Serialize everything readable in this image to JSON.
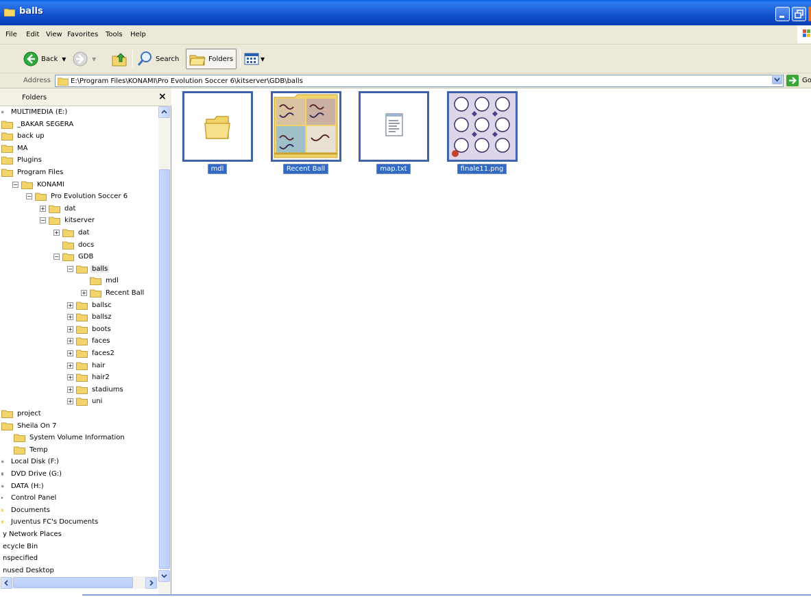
{
  "window": {
    "title": "balls",
    "controls": [
      "minimize",
      "restore"
    ]
  },
  "menu": [
    "File",
    "Edit",
    "View",
    "Favorites",
    "Tools",
    "Help"
  ],
  "toolbar": {
    "back_label": "Back",
    "search_label": "Search",
    "folders_label": "Folders"
  },
  "address": {
    "label": "Address",
    "path": "E:\\Program Files\\KONAMI\\Pro Evolution Soccer 6\\kitserver\\GDB\\balls",
    "go_label": "Go"
  },
  "folders_pane": {
    "title": "Folders",
    "close": "×",
    "tree": [
      {
        "label": "MULTIMEDIA (E:)",
        "icon": "drive-icon",
        "expander": "none"
      },
      {
        "label": "_BAKAR SEGERA",
        "icon": "folder-icon",
        "expander": "none"
      },
      {
        "label": "back up",
        "icon": "folder-icon",
        "expander": "none"
      },
      {
        "label": "MA",
        "icon": "folder-icon",
        "expander": "none"
      },
      {
        "label": "Plugins",
        "icon": "folder-icon",
        "expander": "none"
      },
      {
        "label": "Program Files",
        "icon": "folder-icon",
        "expander": "none"
      },
      {
        "label": "KONAMI",
        "icon": "folder-icon",
        "expander": "minus"
      },
      {
        "label": "Pro Evolution Soccer 6",
        "icon": "folder-icon",
        "expander": "minus"
      },
      {
        "label": "dat",
        "icon": "folder-icon",
        "expander": "plus"
      },
      {
        "label": "kitserver",
        "icon": "folder-icon",
        "expander": "minus"
      },
      {
        "label": "dat",
        "icon": "folder-icon",
        "expander": "plus"
      },
      {
        "label": "docs",
        "icon": "folder-icon",
        "expander": "none"
      },
      {
        "label": "GDB",
        "icon": "folder-icon",
        "expander": "minus"
      },
      {
        "label": "balls",
        "icon": "folder-icon",
        "expander": "minus",
        "selected": true
      },
      {
        "label": "mdl",
        "icon": "folder-icon",
        "expander": "none"
      },
      {
        "label": "Recent Ball",
        "icon": "folder-icon",
        "expander": "plus"
      },
      {
        "label": "ballsc",
        "icon": "folder-icon",
        "expander": "plus"
      },
      {
        "label": "ballsz",
        "icon": "folder-icon",
        "expander": "plus"
      },
      {
        "label": "boots",
        "icon": "folder-icon",
        "expander": "plus"
      },
      {
        "label": "faces",
        "icon": "folder-icon",
        "expander": "plus"
      },
      {
        "label": "faces2",
        "icon": "folder-icon",
        "expander": "plus"
      },
      {
        "label": "hair",
        "icon": "folder-icon",
        "expander": "plus"
      },
      {
        "label": "hair2",
        "icon": "folder-icon",
        "expander": "plus"
      },
      {
        "label": "stadiums",
        "icon": "folder-icon",
        "expander": "plus"
      },
      {
        "label": "uni",
        "icon": "folder-icon",
        "expander": "plus"
      },
      {
        "label": "project",
        "icon": "folder-icon",
        "expander": "none"
      },
      {
        "label": "Sheila On 7",
        "icon": "folder-icon",
        "expander": "none"
      },
      {
        "label": "System Volume Information",
        "icon": "folder-icon",
        "expander": "none"
      },
      {
        "label": "Temp",
        "icon": "folder-icon",
        "expander": "none"
      },
      {
        "label": "Local Disk (F:)",
        "icon": "drive-icon",
        "expander": "none"
      },
      {
        "label": "DVD Drive (G:)",
        "icon": "dvd-icon",
        "expander": "none"
      },
      {
        "label": "DATA (H:)",
        "icon": "drive-icon",
        "expander": "none"
      },
      {
        "label": "Control Panel",
        "icon": "control-panel-icon",
        "expander": "none"
      },
      {
        "label": "Documents",
        "icon": "documents-icon",
        "expander": "none"
      },
      {
        "label": "Juventus FC's Documents",
        "icon": "documents-icon",
        "expander": "none"
      },
      {
        "label": "y Network Places",
        "icon": "",
        "expander": "none"
      },
      {
        "label": "ecycle Bin",
        "icon": "",
        "expander": "none"
      },
      {
        "label": "nspecified",
        "icon": "",
        "expander": "none"
      },
      {
        "label": "nused Desktop",
        "icon": "",
        "expander": "none"
      }
    ]
  },
  "files": [
    {
      "name": "mdl",
      "type": "folder-icon"
    },
    {
      "name": "Recent Ball",
      "type": "folder-thumbnail"
    },
    {
      "name": "map.txt",
      "type": "text-file-icon"
    },
    {
      "name": "finale11.png",
      "type": "image-thumbnail"
    }
  ],
  "colors": {
    "titlebar": "#0a47c2",
    "selection": "#316ac5",
    "chrome": "#ece9d8",
    "folder": "#f3d46a"
  }
}
